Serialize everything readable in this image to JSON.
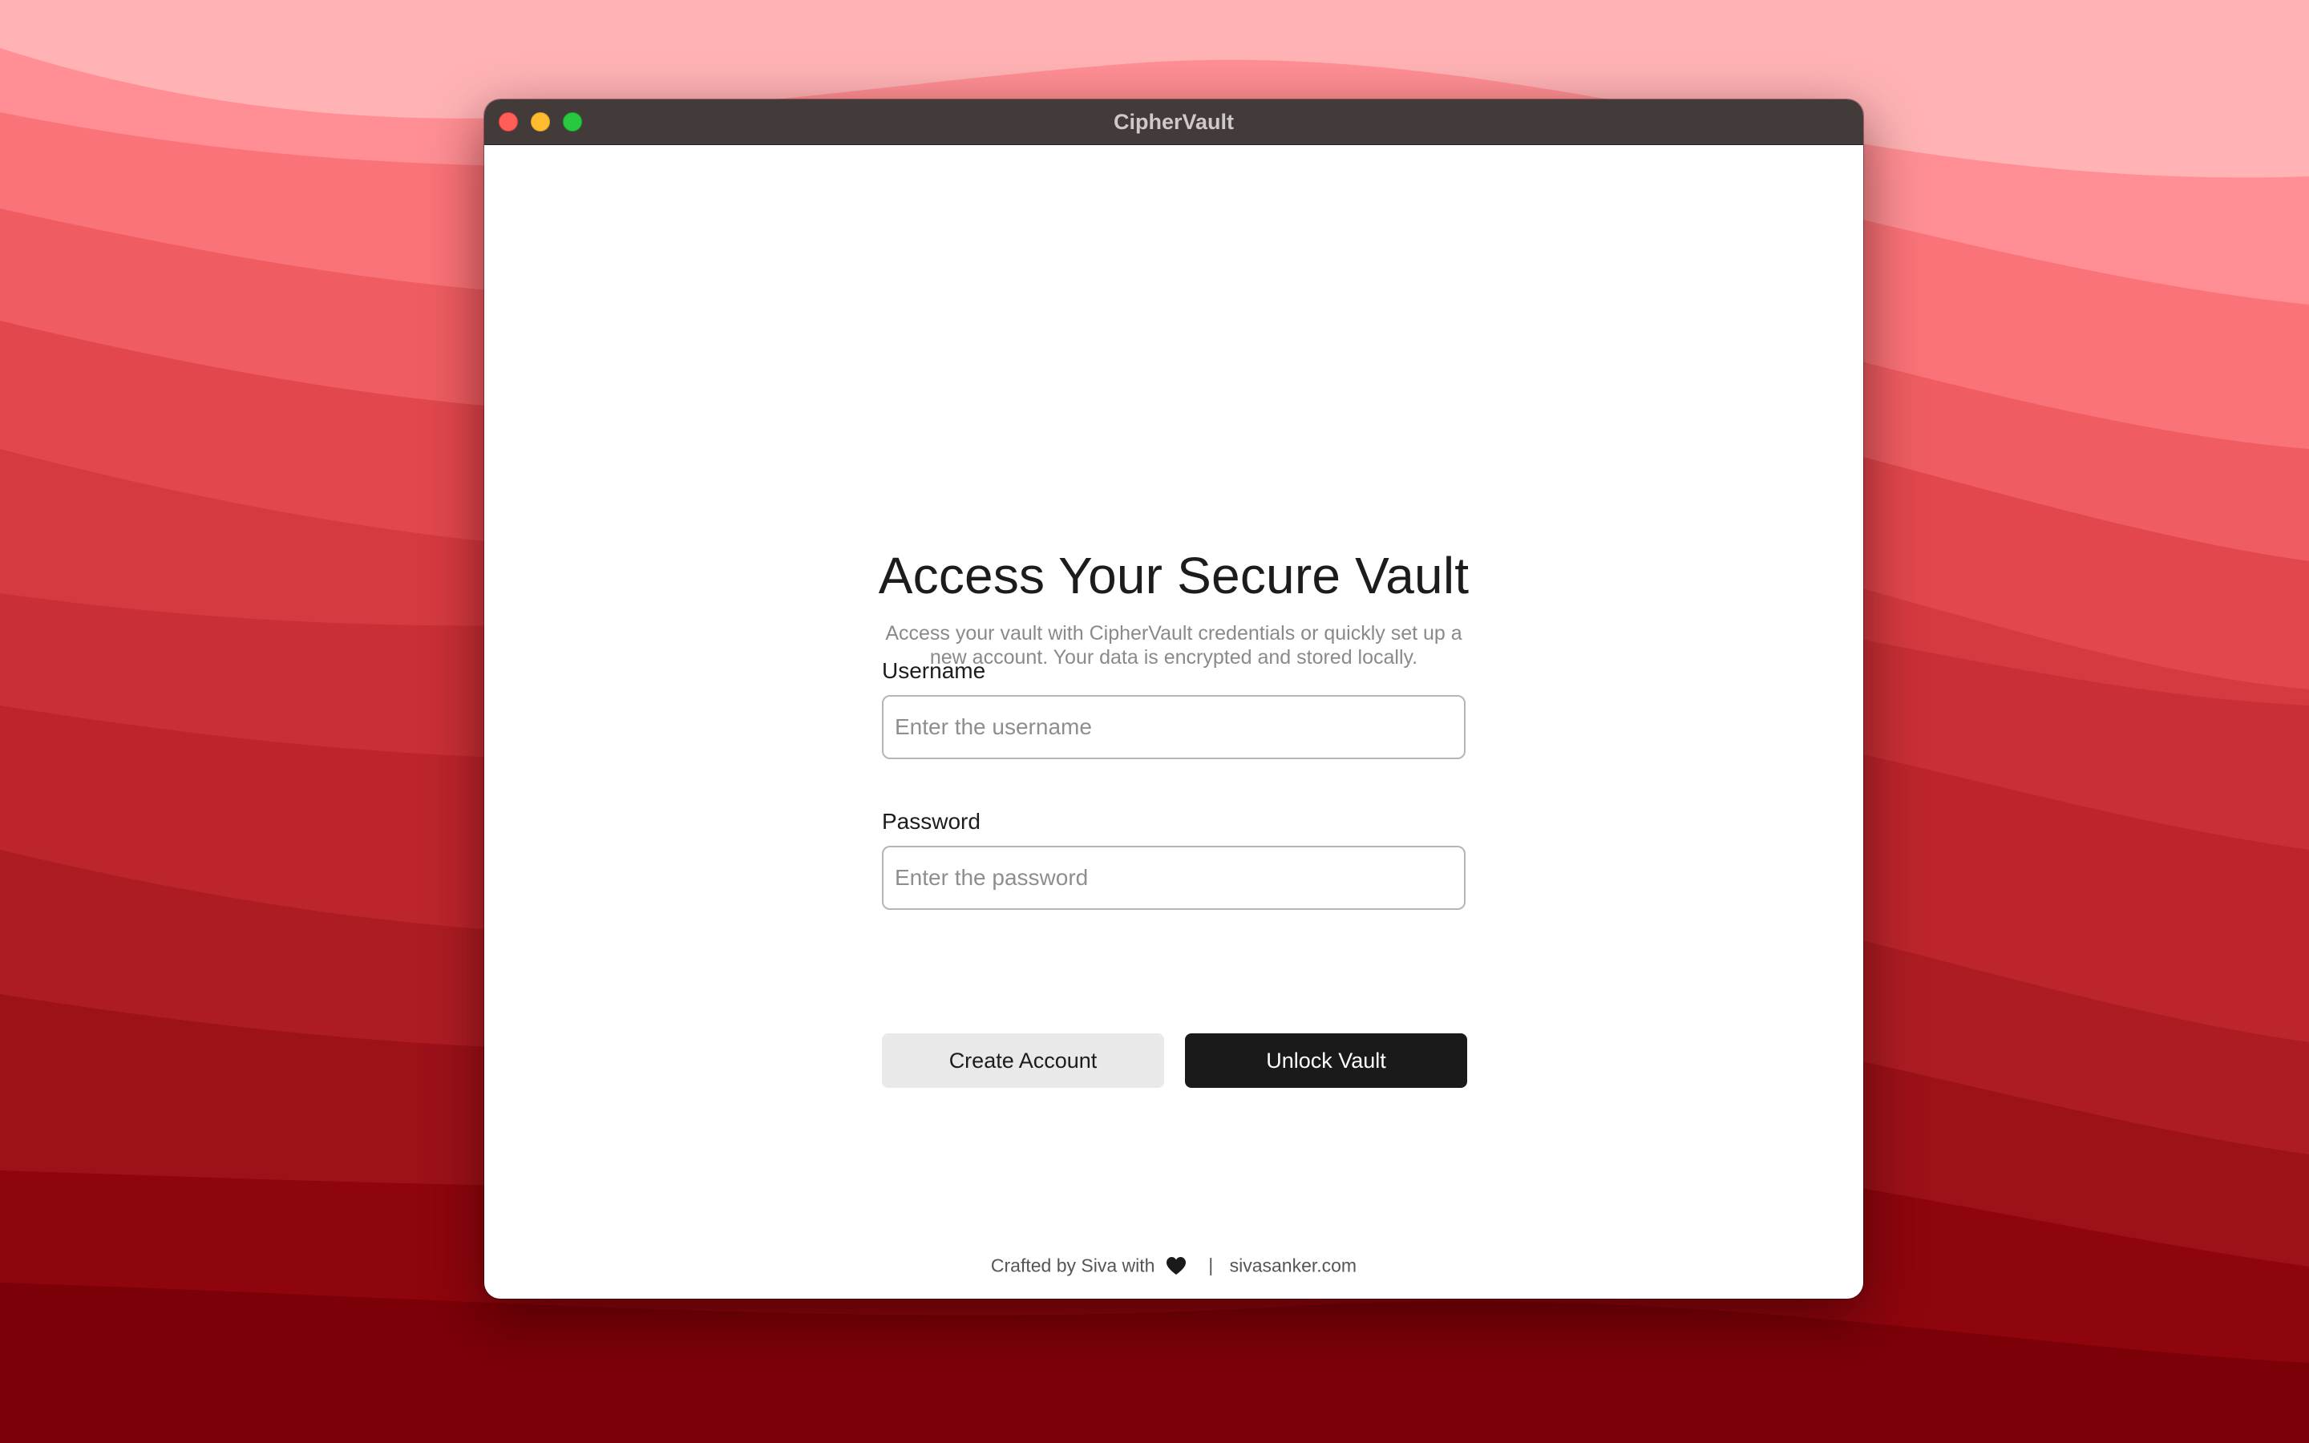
{
  "window": {
    "title": "CipherVault"
  },
  "login": {
    "heading": "Access Your Secure Vault",
    "subtitle": "Access your vault with CipherVault credentials or quickly set up a new account. Your data is encrypted and stored locally.",
    "username_label": "Username",
    "username_placeholder": "Enter the username",
    "username_value": "",
    "password_label": "Password",
    "password_placeholder": "Enter the password",
    "password_value": "",
    "create_button": "Create Account",
    "unlock_button": "Unlock Vault"
  },
  "footer": {
    "credit_prefix": "Crafted by Siva with",
    "heart_icon": "black-heart-icon",
    "separator": "|",
    "link": "sivasanker.com"
  },
  "colors": {
    "primary_button": "#1a1a1a",
    "secondary_button": "#e9e9e9",
    "titlebar": "#433a3a",
    "wallpaper_accent": "#c0202a"
  }
}
